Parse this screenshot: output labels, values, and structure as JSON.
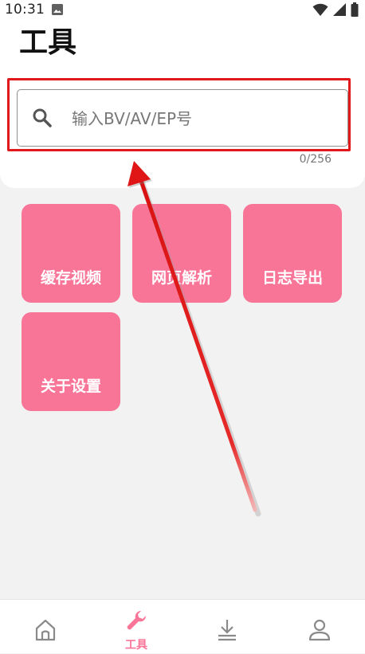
{
  "status_bar": {
    "time": "10:31"
  },
  "page": {
    "title": "工具"
  },
  "search": {
    "placeholder": "输入BV/AV/EP号",
    "value": "",
    "counter": "0/256"
  },
  "tools": [
    {
      "label": "缓存视频"
    },
    {
      "label": "网页解析"
    },
    {
      "label": "日志导出"
    },
    {
      "label": "关于设置"
    }
  ],
  "bottom_nav": {
    "items": [
      {
        "icon": "home-icon",
        "label": ""
      },
      {
        "icon": "wrench-icon",
        "label": "工具",
        "active": true
      },
      {
        "icon": "download-icon",
        "label": ""
      },
      {
        "icon": "person-icon",
        "label": ""
      }
    ]
  },
  "colors": {
    "accent": "#f97598",
    "annotation": "#e2191b"
  }
}
